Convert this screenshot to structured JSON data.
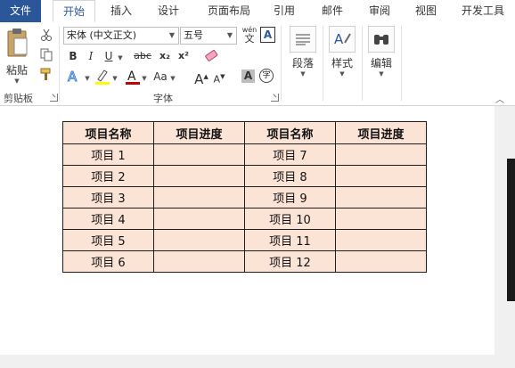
{
  "tabs": [
    "文件",
    "开始",
    "插入",
    "设计",
    "页面布局",
    "引用",
    "邮件",
    "审阅",
    "视图",
    "开发工具"
  ],
  "active_tab": "开始",
  "clipboard": {
    "paste_label": "粘贴",
    "group_label": "剪贴板"
  },
  "font": {
    "font_name": "宋体 (中文正文)",
    "font_size": "五号",
    "wen_glyph": "wén",
    "wen_sub": "文",
    "border_A": "A",
    "bold": "B",
    "italic": "I",
    "underline": "U",
    "strike": "abc",
    "subscript": "x₂",
    "superscript": "x²",
    "grow": "A",
    "shrink": "A",
    "case": "Aa",
    "shade_A": "A",
    "circle_char": "字",
    "group_label": "字体"
  },
  "paragraph": {
    "label": "段落"
  },
  "styles": {
    "label": "样式"
  },
  "editing": {
    "label": "编辑"
  },
  "table": {
    "headers": [
      "项目名称",
      "项目进度",
      "项目名称",
      "项目进度"
    ],
    "rows": [
      [
        "项目 1",
        "",
        "项目 7",
        ""
      ],
      [
        "项目 2",
        "",
        "项目 8",
        ""
      ],
      [
        "项目 3",
        "",
        "项目 9",
        ""
      ],
      [
        "项目 4",
        "",
        "项目 10",
        ""
      ],
      [
        "项目 5",
        "",
        "项目 11",
        ""
      ],
      [
        "项目 6",
        "",
        "项目 12",
        ""
      ]
    ],
    "cell_color": "#fbe4d5",
    "border_color": "#1f1f1f"
  },
  "colors": {
    "accent": "#2b579a",
    "font_color_bar": "#c00000",
    "highlight_bar": "#ffff00"
  }
}
